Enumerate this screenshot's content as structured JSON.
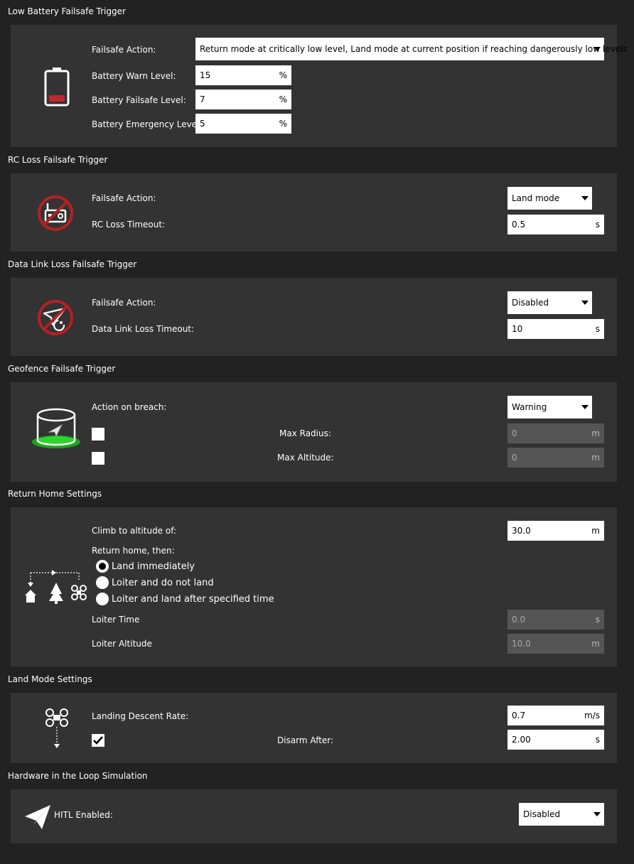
{
  "battery": {
    "title": "Low Battery Failsafe Trigger",
    "action_label": "Failsafe Action:",
    "action_value": "Return mode at critically low level, Land mode at current position if reaching dangerously low levels",
    "warn_label": "Battery Warn Level:",
    "warn_value": "15",
    "failsafe_label": "Battery Failsafe Level:",
    "failsafe_value": "7",
    "emergency_label": "Battery Emergency Level:",
    "emergency_value": "5",
    "unit": "%",
    "icon": "battery-low-icon"
  },
  "rc_loss": {
    "title": "RC Loss Failsafe Trigger",
    "action_label": "Failsafe Action:",
    "action_value": "Land mode",
    "timeout_label": "RC Loss Timeout:",
    "timeout_value": "0.5",
    "unit": "s",
    "icon": "rc-loss-icon"
  },
  "datalink": {
    "title": "Data Link Loss Failsafe Trigger",
    "action_label": "Failsafe Action:",
    "action_value": "Disabled",
    "timeout_label": "Data Link Loss Timeout:",
    "timeout_value": "10",
    "unit": "s",
    "icon": "datalink-loss-icon"
  },
  "geofence": {
    "title": "Geofence Failsafe Trigger",
    "action_label": "Action on breach:",
    "action_value": "Warning",
    "radius_label": "Max Radius:",
    "radius_value": "0",
    "radius_unit": "m",
    "altitude_label": "Max Altitude:",
    "altitude_value": "0",
    "altitude_unit": "m",
    "icon": "geofence-icon"
  },
  "rth": {
    "title": "Return Home Settings",
    "climb_label": "Climb to altitude of:",
    "climb_value": "30.0",
    "climb_unit": "m",
    "then_label": "Return home, then:",
    "options": [
      "Land immediately",
      "Loiter and do not land",
      "Loiter and land after specified time"
    ],
    "selected_option": "Land immediately",
    "loiter_time_label": "Loiter Time",
    "loiter_time_value": "0.0",
    "loiter_time_unit": "s",
    "loiter_alt_label": "Loiter Altitude",
    "loiter_alt_value": "10.0",
    "loiter_alt_unit": "m",
    "icon": "return-home-icon"
  },
  "land": {
    "title": "Land Mode Settings",
    "descent_label": "Landing Descent Rate:",
    "descent_value": "0.7",
    "descent_unit": "m/s",
    "disarm_label": "Disarm After:",
    "disarm_value": "2.00",
    "disarm_unit": "s",
    "disarm_checked": true,
    "icon": "land-mode-icon"
  },
  "hitl": {
    "title": "Hardware in the Loop Simulation",
    "enabled_label": "HITL Enabled:",
    "enabled_value": "Disabled",
    "icon": "paper-plane-icon"
  },
  "colors": {
    "background": "#222222",
    "panel": "#333333",
    "battery_red": "#c0282d",
    "geofence_green": "#22c322",
    "disabled_field": "#555555"
  }
}
